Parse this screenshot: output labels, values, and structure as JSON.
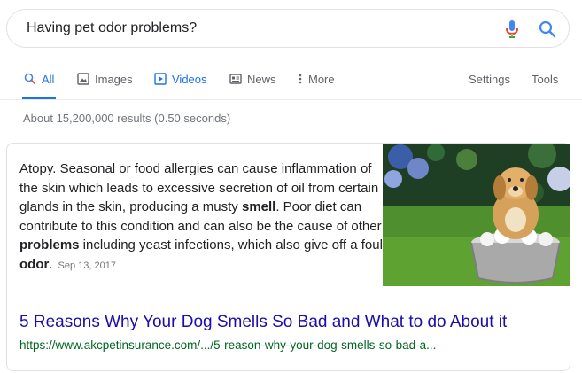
{
  "search": {
    "query": "Having pet odor problems?"
  },
  "tabs": [
    {
      "label": "All",
      "icon": "search-icon"
    },
    {
      "label": "Images",
      "icon": "image-icon"
    },
    {
      "label": "Videos",
      "icon": "play-icon"
    },
    {
      "label": "News",
      "icon": "newspaper-icon"
    },
    {
      "label": "More",
      "icon": "more-vert-icon"
    }
  ],
  "tools": {
    "settings_label": "Settings",
    "tools_label": "Tools"
  },
  "results_stats": "About 15,200,000 results (0.50 seconds)",
  "featured_snippet": {
    "text_1": "Atopy. Seasonal or food allergies can cause inflammation of the skin which leads to excessive secretion of oil from certain glands in the skin, producing a musty ",
    "bold_1": "smell",
    "text_2": ". Poor diet can contribute to this condition and can also be the cause of other ",
    "bold_2": "problems",
    "text_3": " including yeast infections, which also give off a foul ",
    "bold_3": "odor",
    "text_4": ".",
    "date": "Sep 13, 2017",
    "image_alt": "golden retriever sitting in a metal wash tub with soap bubbles on grass",
    "title": "5 Reasons Why Your Dog Smells So Bad and What to do About it",
    "url": "https://www.akcpetinsurance.com/.../5-reason-why-your-dog-smells-so-bad-a..."
  },
  "colors": {
    "accent": "#1a73e8",
    "link": "#1a0dab",
    "url": "#006621",
    "muted": "#70757a"
  }
}
